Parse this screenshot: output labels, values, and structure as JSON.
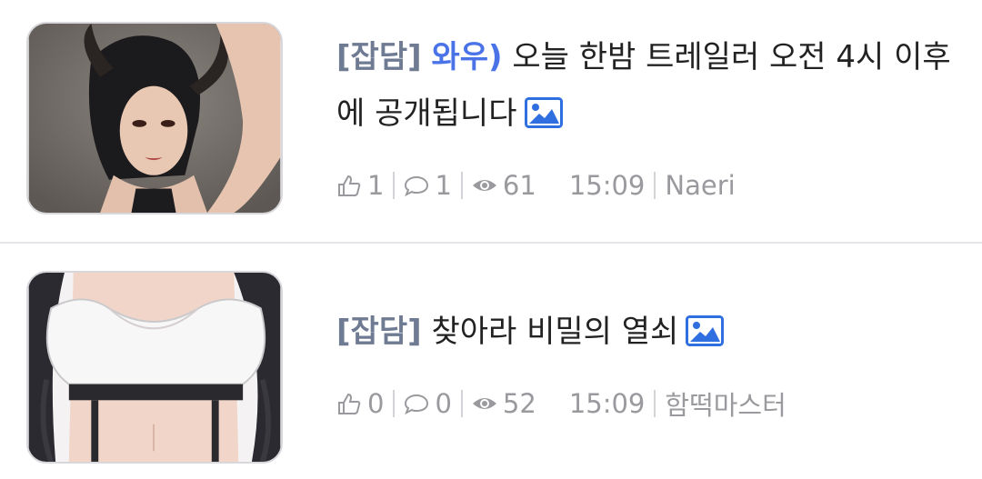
{
  "posts": [
    {
      "category": "[잡담]",
      "prefix": "와우)",
      "title": " 오늘 한밤 트레일러 오전 4시 이후에 공개됩니다",
      "likes": "1",
      "comments": "1",
      "views": "61",
      "time": "15:09",
      "author": "Naeri",
      "has_image": true,
      "thumbnail_icon": "image-thumbnail"
    },
    {
      "category": "[잡담]",
      "prefix": "",
      "title": " 찾아라 비밀의 열쇠",
      "likes": "0",
      "comments": "0",
      "views": "52",
      "time": "15:09",
      "author": "함떡마스터",
      "has_image": true,
      "thumbnail_icon": "image-thumbnail"
    }
  ],
  "icons": {
    "like": "thumbs-up-icon",
    "comment": "speech-bubble-icon",
    "views": "eye-icon",
    "image": "image-attachment-icon"
  },
  "colors": {
    "category": "#6f7b92",
    "prefix": "#4a73e8",
    "title": "#222222",
    "meta": "#9a9a9e",
    "image_icon": "#2f6fe0"
  }
}
